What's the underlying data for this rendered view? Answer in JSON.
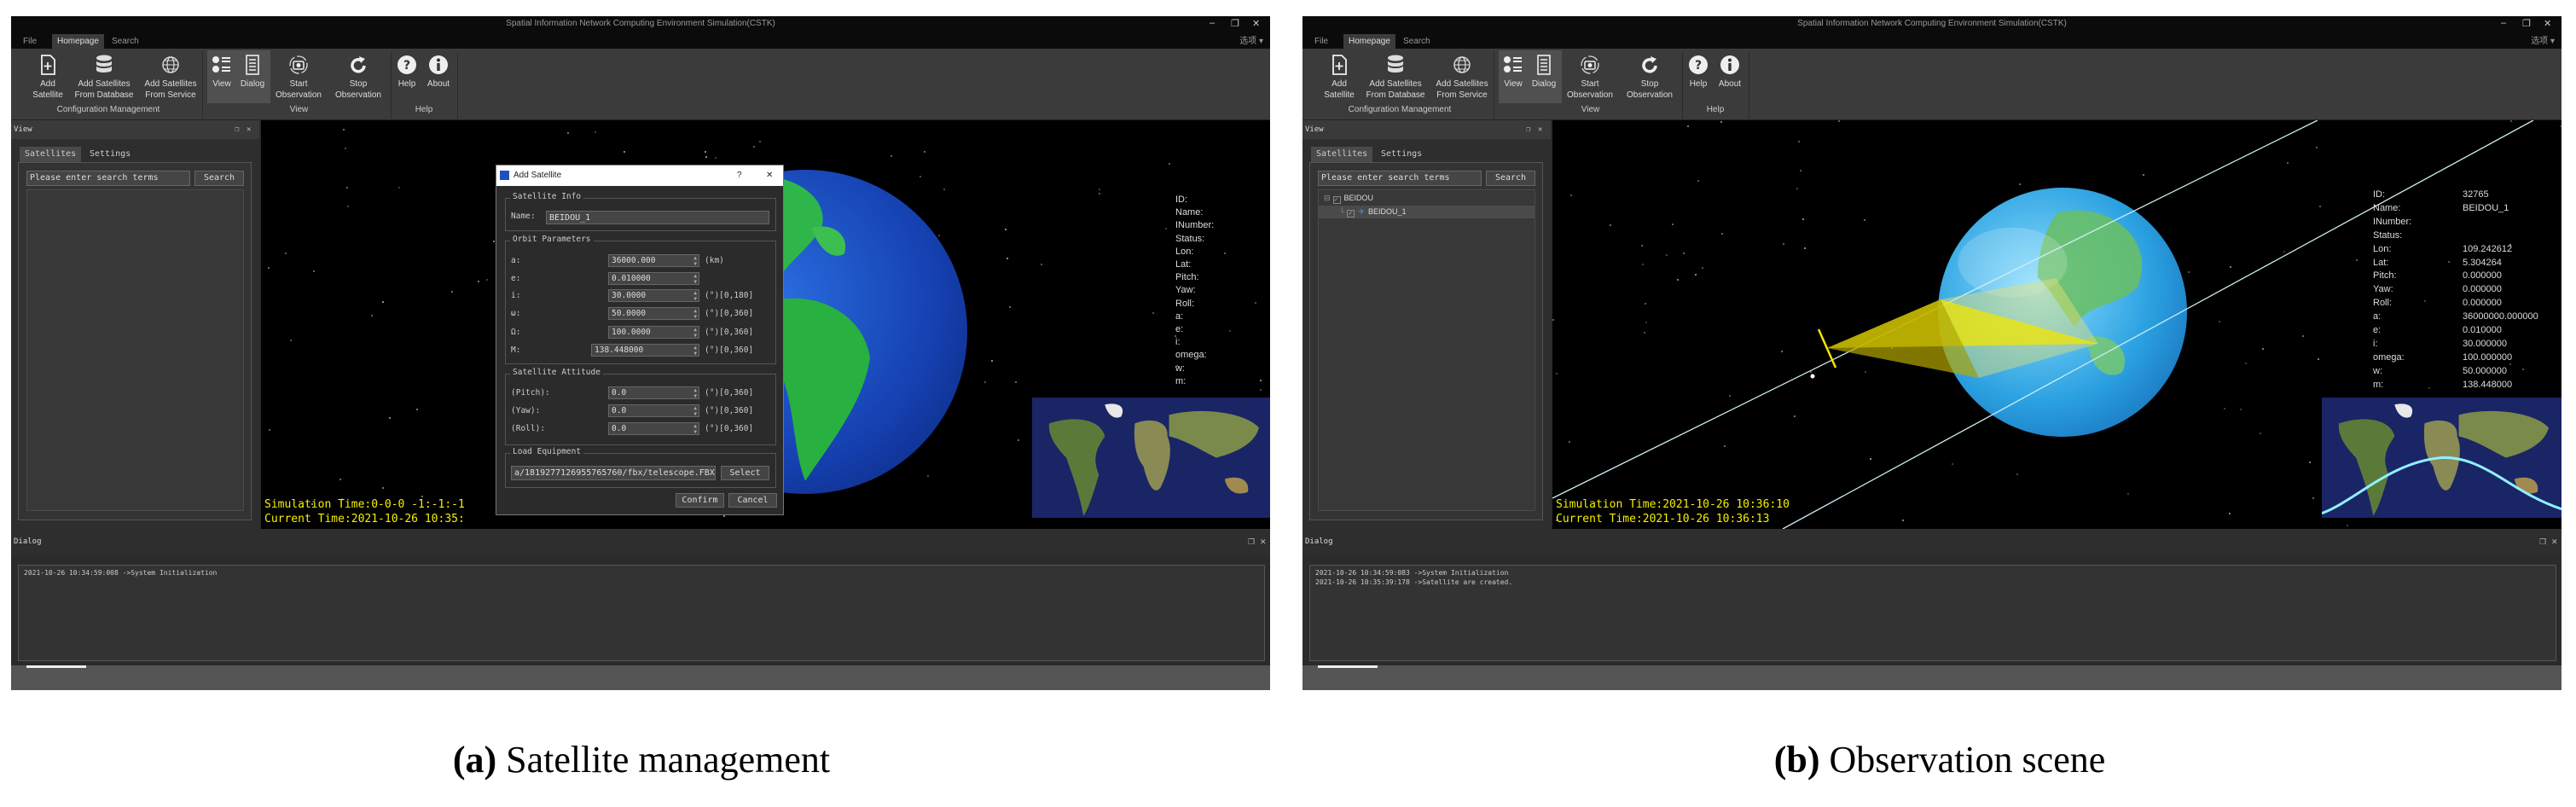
{
  "app": {
    "window_title": "Spatial Information Network Computing Environment Simulation(CSTK)",
    "options_label": "选项 ▾",
    "window_controls": [
      "–",
      "❐",
      "✕"
    ],
    "menu_tabs": [
      "File",
      "Homepage",
      "Search"
    ],
    "selected_menu_tab": "Homepage",
    "ribbon": {
      "buttons": [
        {
          "icon": "add-file-icon",
          "line1": "Add",
          "line2": "Satellite"
        },
        {
          "icon": "database-icon",
          "line1": "Add Satellites",
          "line2": "From Database"
        },
        {
          "icon": "globe-icon",
          "line1": "Add Satellites",
          "line2": "From Service"
        },
        {
          "icon": "view-list-icon",
          "line1": "View",
          "line2": ""
        },
        {
          "icon": "dialog-icon",
          "line1": "Dialog",
          "line2": ""
        },
        {
          "icon": "camera-icon",
          "line1": "Start",
          "line2": "Observation"
        },
        {
          "icon": "refresh-icon",
          "line1": "Stop",
          "line2": "Observation"
        },
        {
          "icon": "help-icon",
          "line1": "Help",
          "line2": ""
        },
        {
          "icon": "info-icon",
          "line1": "About",
          "line2": ""
        }
      ],
      "groups": [
        "Configuration Management",
        "View",
        "Help"
      ]
    },
    "view_dock": {
      "title": "View",
      "tabs": [
        "Satellites",
        "Settings"
      ],
      "search_placeholder": "Please enter search terms",
      "search_button": "Search"
    },
    "dialog_dock_title": "Dialog",
    "info_labels": [
      "ID:",
      "Name:",
      "INumber:",
      "Status:",
      "Lon:",
      "Lat:",
      "Pitch:",
      "Yaw:",
      "Roll:",
      "a:",
      "e:",
      "i:",
      "omega:",
      "w:",
      "m:"
    ],
    "colors": {
      "background": "#2b2b2b",
      "scene": "#000000",
      "time_text": "#f5f000",
      "orbit": "#9fe8ff",
      "cone": "#f2e600"
    }
  },
  "panels": [
    {
      "label": "(a)",
      "caption": "Satellite management",
      "tree": [],
      "simulation_time": "Simulation Time:0-0-0 -1:-1:-1",
      "current_time": "Current Time:2021-10-26 10:35:",
      "info_values": [],
      "log": [
        "2021-10-26 10:34:59:008 ->System Initialization"
      ],
      "add_satellite_dialog": {
        "title": "Add Satellite",
        "help": "?",
        "close": "✕",
        "satellite_info_label": "Satellite Info",
        "name_label": "Name:",
        "name_value": "BEIDOU_1",
        "orbit_label": "Orbit Parameters",
        "orbit_fields": [
          {
            "label": "a:",
            "value": "36000.000",
            "unit": "(km)"
          },
          {
            "label": "e:",
            "value": "0.010000",
            "unit": ""
          },
          {
            "label": "i:",
            "value": "30.0000",
            "unit": "(°)[0,180]"
          },
          {
            "label": "ω:",
            "value": "50.0000",
            "unit": "(°)[0,360]"
          },
          {
            "label": "Ω:",
            "value": "100.0000",
            "unit": "(°)[0,360]"
          },
          {
            "label": "M:",
            "value": "138.448000",
            "unit": "(°)[0,360]"
          }
        ],
        "attitude_label": "Satellite Attitude",
        "attitude_fields": [
          {
            "label": "(Pitch):",
            "value": "0.0",
            "unit": "(°)[0,360]"
          },
          {
            "label": "(Yaw):",
            "value": "0.0",
            "unit": "(°)[0,360]"
          },
          {
            "label": "(Roll):",
            "value": "0.0",
            "unit": "(°)[0,360]"
          }
        ],
        "load_label": "Load Equipment",
        "load_path": "a/1819277126955765760/fbx/telescope.FBX",
        "select_button": "Select",
        "confirm_button": "Confirm",
        "cancel_button": "Cancel"
      }
    },
    {
      "label": "(b)",
      "caption": "Observation scene",
      "tree": [
        {
          "label": "BEIDOU",
          "level": 0,
          "checked": true
        },
        {
          "label": "BEIDOU_1",
          "level": 1,
          "checked": true,
          "selected": true
        }
      ],
      "simulation_time": "Simulation Time:2021-10-26 10:36:10",
      "current_time": "Current Time:2021-10-26 10:36:13",
      "info_values": [
        "32765",
        "BEIDOU_1",
        "",
        "",
        "109.242612",
        "5.304264",
        "0.000000",
        "0.000000",
        "0.000000",
        "36000000.000000",
        "0.010000",
        "30.000000",
        "100.000000",
        "50.000000",
        "138.448000"
      ],
      "log": [
        "2021-10-26 10:34:59:083 ->System Initialization",
        "2021-10-26 10:35:39:178 ->Satellite are created."
      ]
    }
  ]
}
